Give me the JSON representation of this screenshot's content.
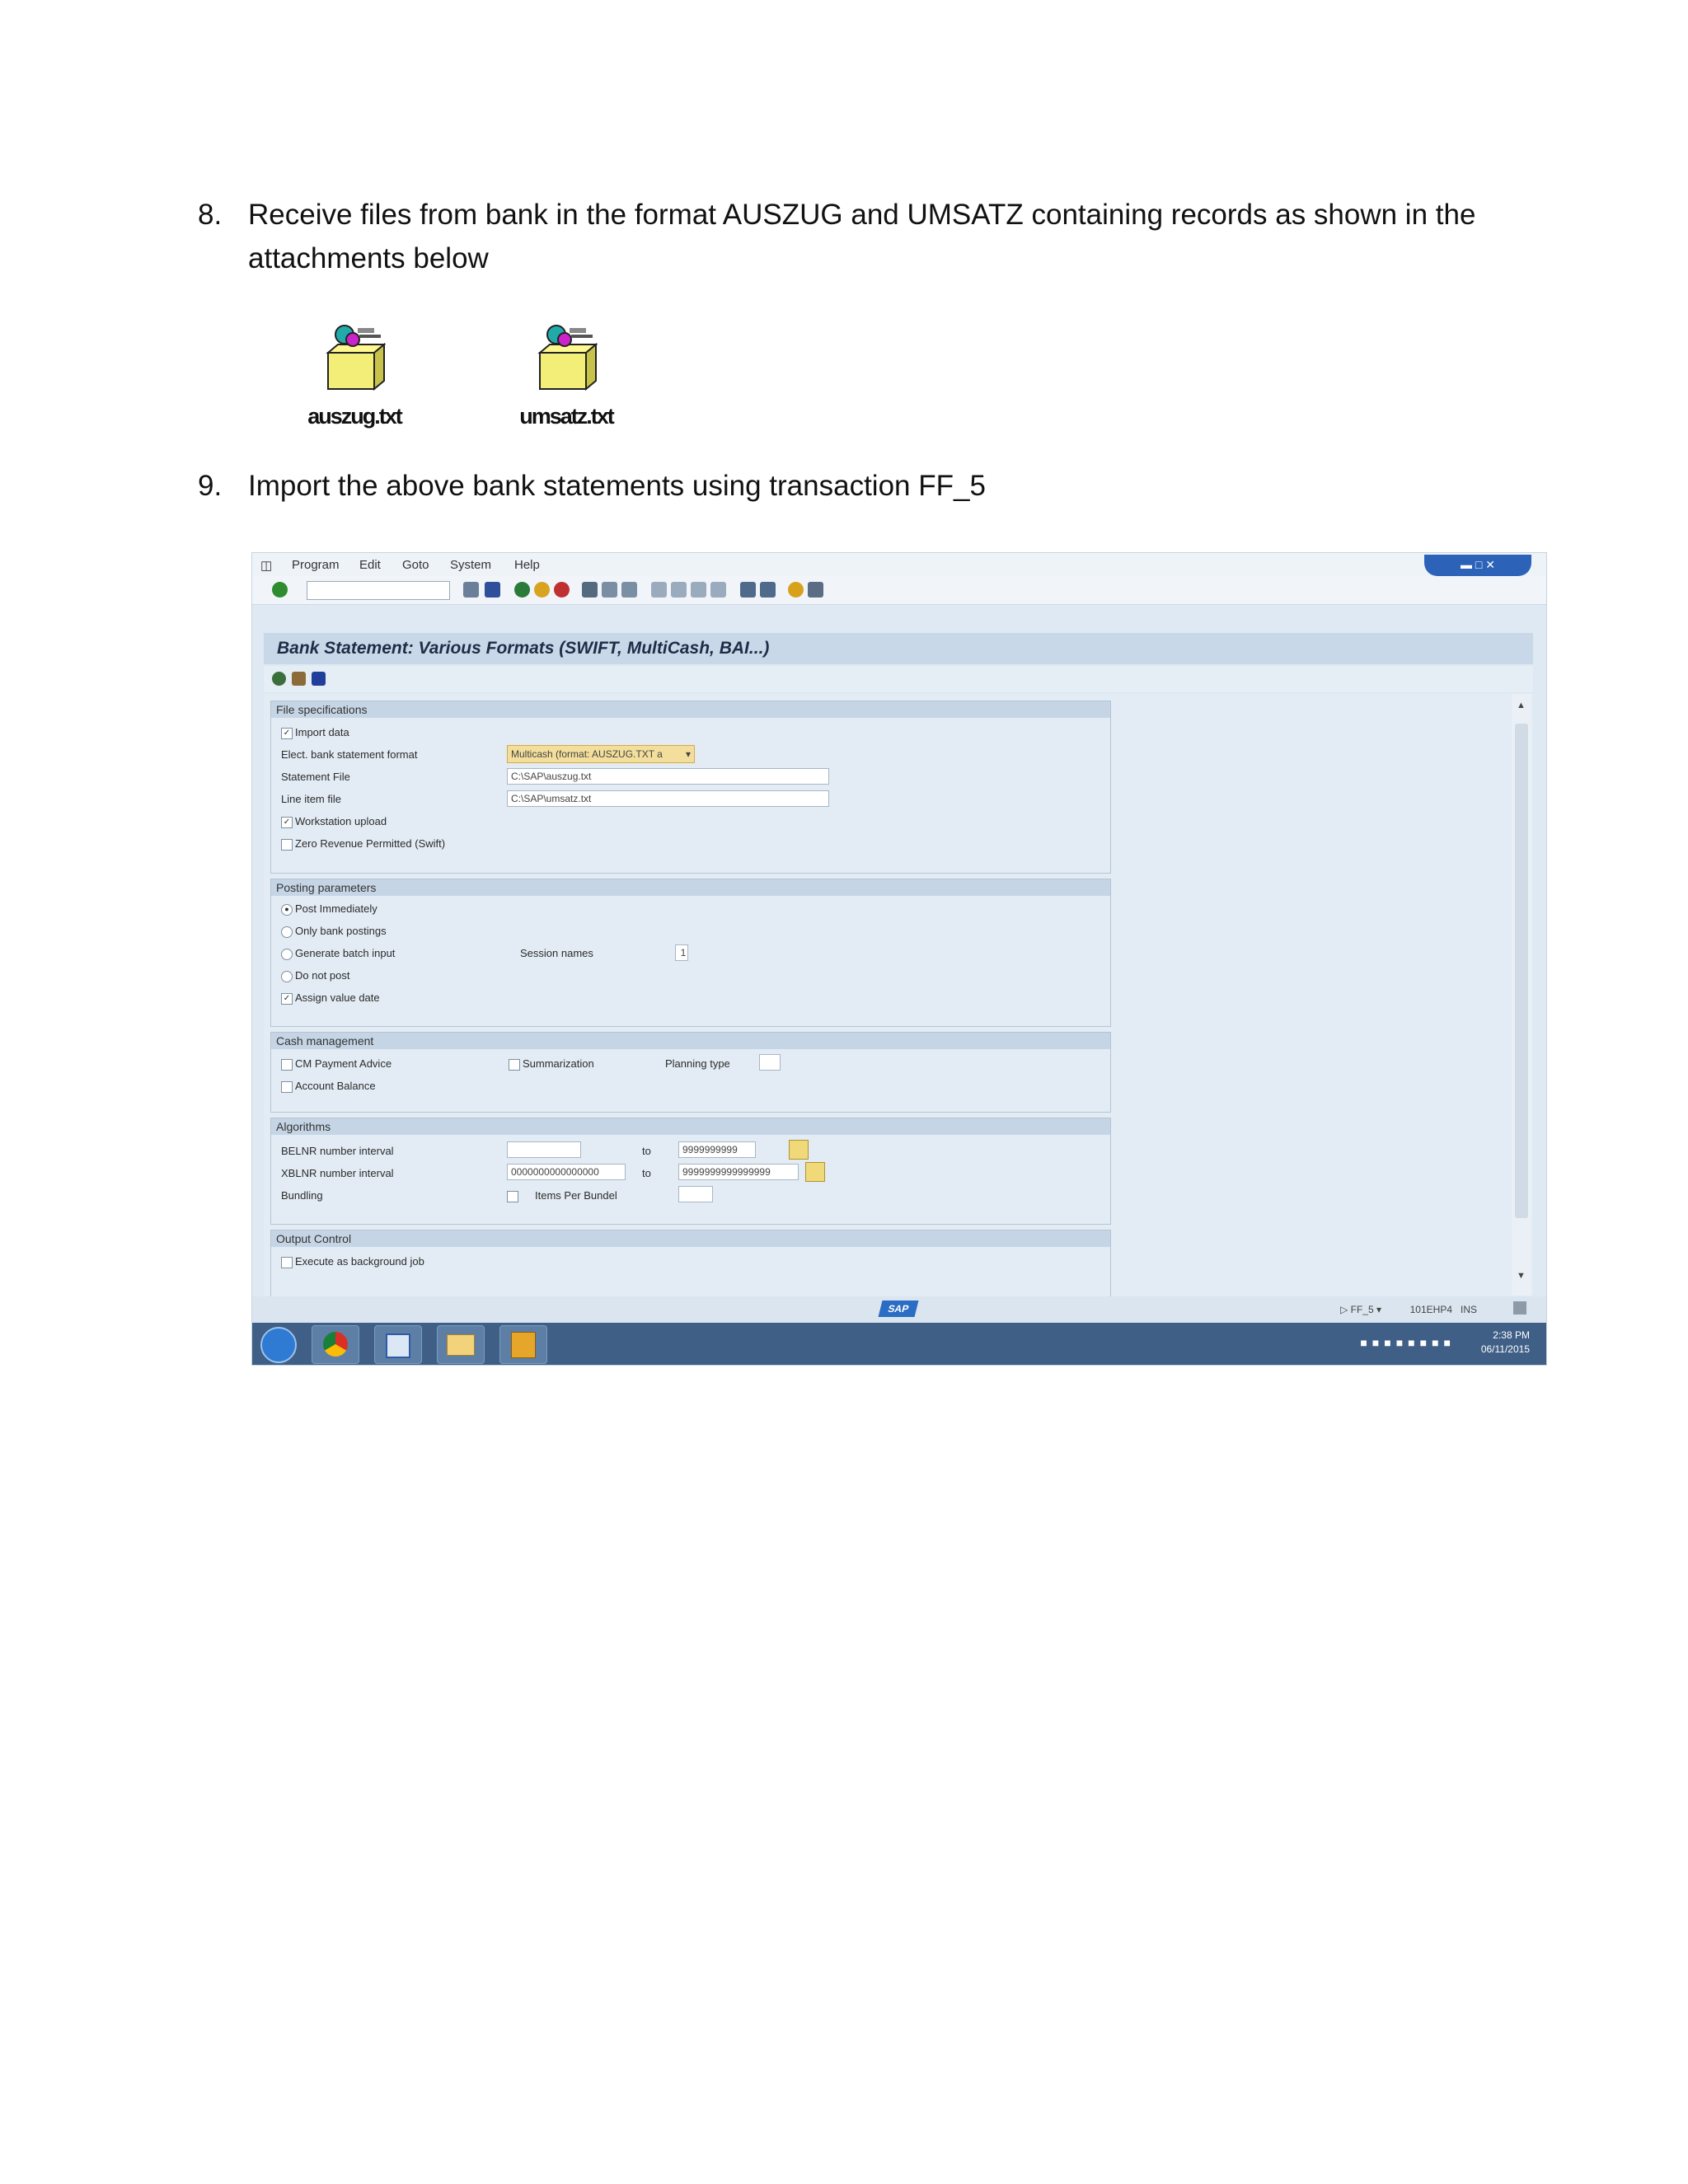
{
  "step8": {
    "number": "8.",
    "text": "Receive files from bank in the format AUSZUG and UMSATZ containing records as shown in the",
    "text2": "attachments below"
  },
  "attachments": [
    {
      "label": "auszug.txt",
      "icon": "package-file-icon"
    },
    {
      "label": "umsatz.txt",
      "icon": "package-file-icon"
    }
  ],
  "step9": {
    "number": "9.",
    "text": "Import the above bank statements using transaction FF_5"
  },
  "sap": {
    "menu": [
      "Program",
      "Edit",
      "Goto",
      "System",
      "Help"
    ],
    "title": "Bank Statement: Various Formats (SWIFT, MultiCash, BAI...)",
    "file_spec": {
      "header": "File specifications",
      "import_data": "Import data",
      "format_label": "Elect. bank statement format",
      "format_value": "Multicash (format: AUSZUG.TXT a",
      "statement_label": "Statement File",
      "statement_value": "C:\\SAP\\auszug.txt",
      "lineitem_label": "Line item file",
      "lineitem_value": "C:\\SAP\\umsatz.txt",
      "workstation": "Workstation upload",
      "zero_revenue": "Zero Revenue Permitted (Swift)"
    },
    "posting": {
      "header": "Posting parameters",
      "post_immediately": "Post Immediately",
      "only_bank": "Only bank postings",
      "generate_batch": "Generate batch input",
      "session_names": "Session names",
      "session_value": "1",
      "do_not_post": "Do not post",
      "assign_value": "Assign value date"
    },
    "cash": {
      "header": "Cash management",
      "cm_payment": "CM Payment Advice",
      "summarization": "Summarization",
      "planning_type": "Planning type",
      "account_balance": "Account Balance"
    },
    "algorithms": {
      "header": "Algorithms",
      "belnr_label": "BELNR number interval",
      "belnr_to": "9999999999",
      "xblnr_label": "XBLNR number interval",
      "xblnr_from": "0000000000000000",
      "xblnr_to": "9999999999999999",
      "to_label": "to",
      "bundling": "Bundling",
      "items_per_bundle": "Items Per Bundel"
    },
    "output": {
      "header": "Output Control",
      "execute_bg": "Execute as background job"
    },
    "status": {
      "transaction": "FF_5",
      "system": "101EHP4",
      "ins": "INS",
      "logo": "SAP"
    },
    "clock": {
      "time": "2:38 PM",
      "date": "06/11/2015"
    }
  }
}
